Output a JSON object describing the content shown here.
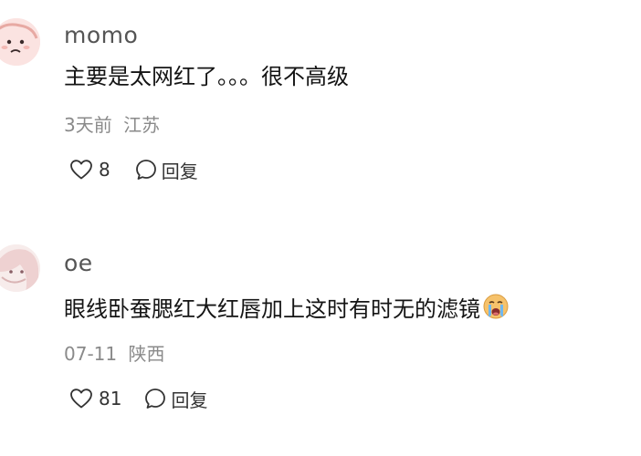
{
  "comments": [
    {
      "username": "momo",
      "text": "主要是太网红了。。。很不高级",
      "time": "3天前",
      "location": "江苏",
      "likes": "8",
      "reply_label": "回复",
      "avatar_icon": "cartoon-face-avatar"
    },
    {
      "username": "oe",
      "text": "眼线卧蚕腮红大红唇加上这时有时无的滤镜",
      "emoji_icon": "crying-face-emoji",
      "time": "07-11",
      "location": "陕西",
      "likes": "81",
      "reply_label": "回复",
      "avatar_icon": "anime-girl-avatar"
    }
  ],
  "colors": {
    "username": "#555555",
    "text": "#141414",
    "meta": "#8a8a8a",
    "action": "#333333"
  }
}
